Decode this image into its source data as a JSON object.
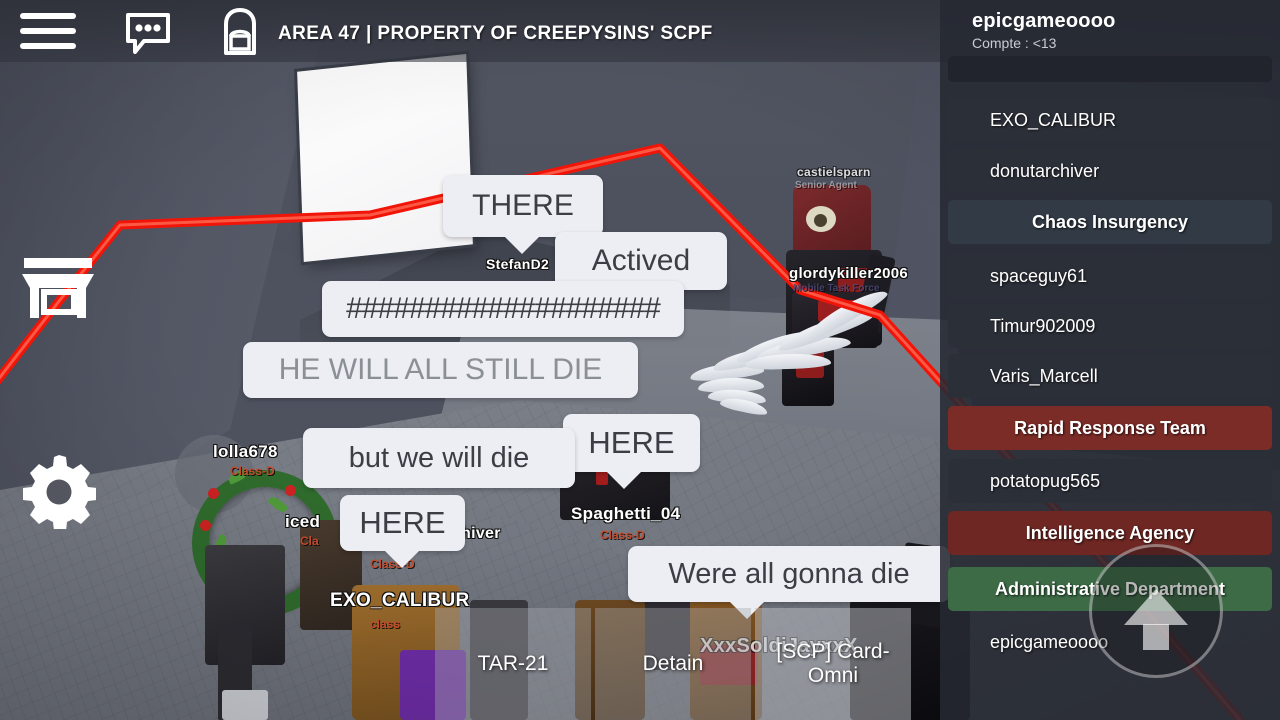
{
  "topbar": {
    "menu_icon": "hamburger-menu-icon",
    "chat_icon": "chat-bubble-icon",
    "inventory_icon": "backpack-icon",
    "title": "AREA 47 | PROPERTY OF CREEPYSINS' SCPF"
  },
  "left_controls": {
    "shop_icon": "shop-icon",
    "settings_icon": "gear-icon"
  },
  "player_list": {
    "header_name": "epicgameoooo",
    "header_sub": "Compte : <13",
    "rows": [
      {
        "label": "",
        "type": "player",
        "cut": true
      },
      {
        "label": "EXO_CALIBUR",
        "type": "player"
      },
      {
        "label": "donutarchiver",
        "type": "player"
      },
      {
        "label": "Chaos Insurgency",
        "type": "team",
        "color": "#323a45"
      },
      {
        "label": "spaceguy61",
        "type": "player"
      },
      {
        "label": "Timur902009",
        "type": "player"
      },
      {
        "label": "Varis_Marcell",
        "type": "player"
      },
      {
        "label": "Rapid Response Team",
        "type": "team",
        "color": "#7c2c27"
      },
      {
        "label": "potatopug565",
        "type": "player"
      },
      {
        "label": "Intelligence Agency",
        "type": "team",
        "color": "#6e2723"
      },
      {
        "label": "Administrative Department",
        "type": "team",
        "color": "#3c6b45"
      },
      {
        "label": "epicgameoooo",
        "type": "player"
      }
    ]
  },
  "chat_bubbles": [
    {
      "text": "THERE",
      "style": "dark"
    },
    {
      "text": "Actived",
      "style": "dark"
    },
    {
      "text": "####################",
      "style": "dark"
    },
    {
      "text": "HE WILL ALL STILL DIE",
      "style": "grey"
    },
    {
      "text": "HERE",
      "style": "dark"
    },
    {
      "text": "but we will die",
      "style": "dark"
    },
    {
      "text": "HERE",
      "style": "dark"
    },
    {
      "text": "Were all gonna die",
      "style": "dark"
    }
  ],
  "world_nametags": [
    {
      "name": "StefanD2"
    },
    {
      "name": "castielsparn",
      "sub": "Senior Agent"
    },
    {
      "name": "glordykiller2006",
      "sub": "Mobile Task Force"
    },
    {
      "name": "lolla678",
      "sub": "Class-D"
    },
    {
      "name": "iced",
      "sub": "Cla"
    },
    {
      "name": "hiver",
      "sub": "Class-D"
    },
    {
      "name": "Spaghetti_04",
      "sub": "Class-D"
    },
    {
      "name": "EXO_CALIBUR",
      "sub": "class"
    },
    {
      "name": "XxxSoldiJayxxX",
      "sub": ""
    }
  ],
  "hotbar": [
    {
      "label": "TAR-21"
    },
    {
      "label": "Detain"
    },
    {
      "label": "[SCP] Card-Omni"
    }
  ],
  "jump_button": {
    "icon": "up-arrow-icon"
  },
  "colors": {
    "laser": "#f01508",
    "panel_bg": "#262932",
    "bubble_bg": "#eceef3",
    "team_red": "#7c2c27",
    "team_green": "#3c6b45",
    "team_blue": "#323a45"
  }
}
